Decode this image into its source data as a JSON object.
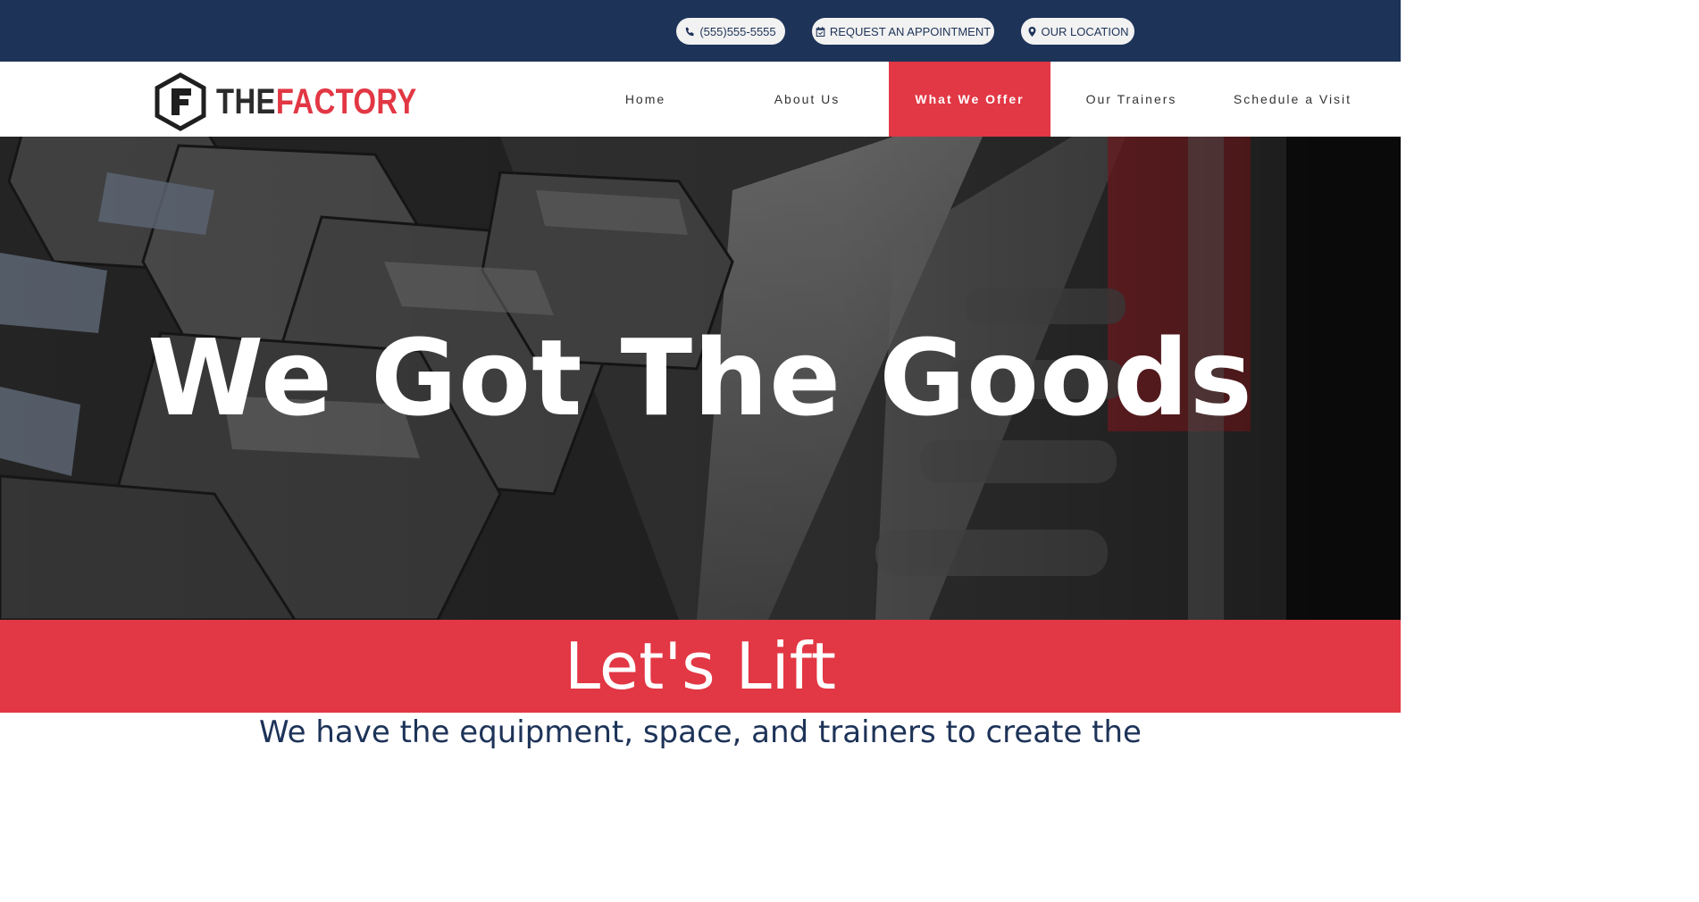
{
  "topbar": {
    "phone": {
      "label": "(555)555-5555",
      "icon": "phone-icon"
    },
    "appointment": {
      "label": "REQUEST AN APPOINTMENT",
      "icon": "calendar-check-icon"
    },
    "location": {
      "label": "OUR LOCATION",
      "icon": "map-marker-icon"
    }
  },
  "brand": {
    "the": "THE",
    "factory": "FACTORY",
    "accent": "#e23744",
    "navy": "#1d3358"
  },
  "nav": {
    "items": [
      {
        "label": "Home"
      },
      {
        "label": "About Us"
      },
      {
        "label": "What We Offer",
        "active": true
      },
      {
        "label": "Our Trainers"
      },
      {
        "label": "Schedule a Visit"
      }
    ]
  },
  "hero": {
    "title": "We Got The Goods"
  },
  "band": {
    "title": "Let's Lift"
  },
  "intro": {
    "text": "We have the equipment, space, and trainers to create the"
  }
}
